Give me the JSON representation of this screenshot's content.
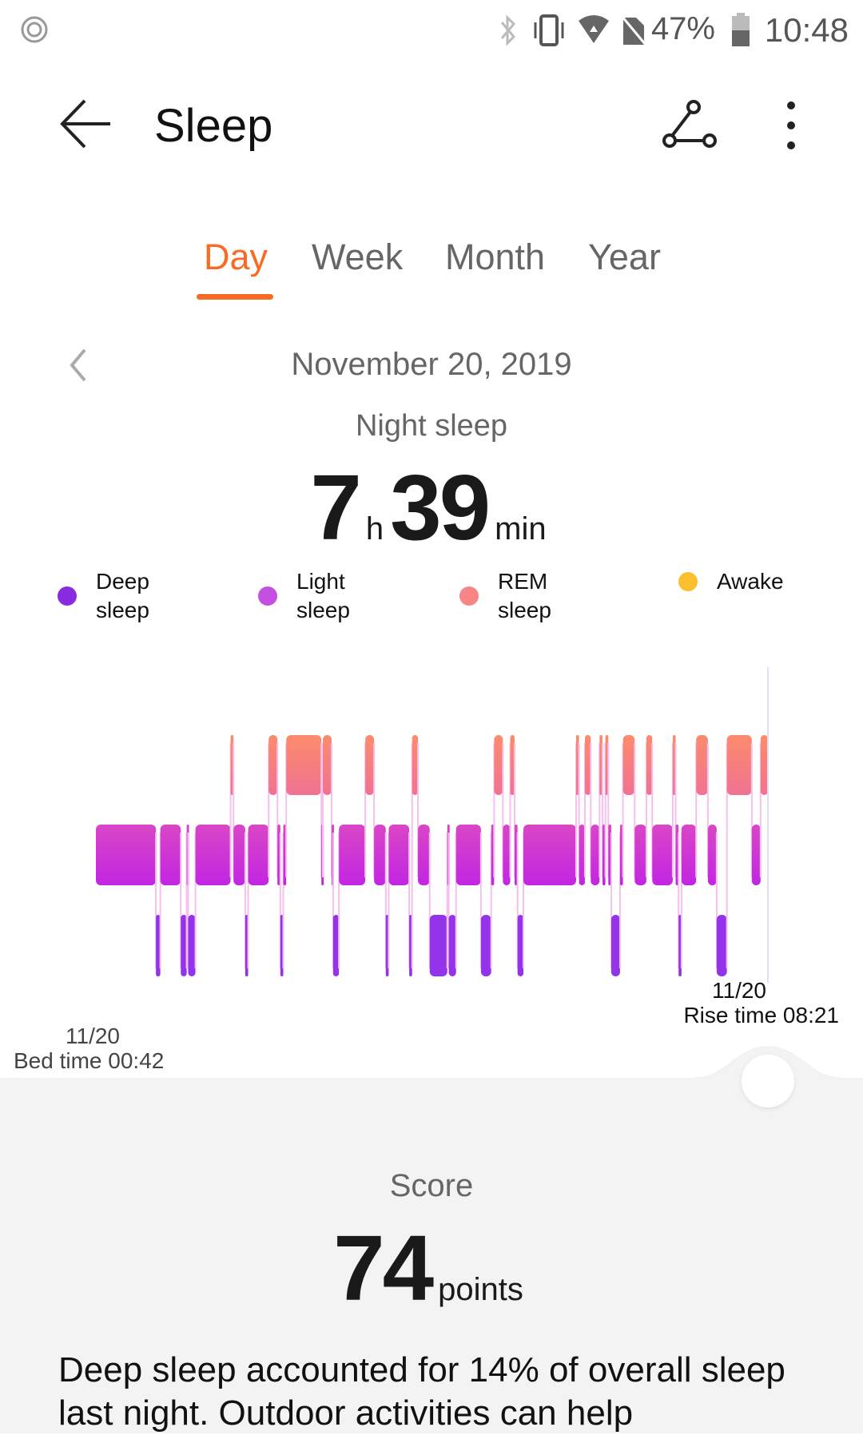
{
  "status_bar": {
    "battery": "47%",
    "time": "10:48",
    "icons": [
      "app-spiral-icon",
      "bluetooth-icon",
      "vibrate-icon",
      "wifi-icon",
      "no-sim-icon",
      "battery-icon"
    ]
  },
  "header": {
    "title": "Sleep",
    "back_icon": "arrow-left-icon",
    "share_icon": "share-icon",
    "more_icon": "more-vertical-icon"
  },
  "tabs": [
    {
      "label": "Day",
      "active": true
    },
    {
      "label": "Week"
    },
    {
      "label": "Month"
    },
    {
      "label": "Year"
    }
  ],
  "date": "November 20, 2019",
  "summary": {
    "label": "Night sleep",
    "hours": "7",
    "hours_unit": "h",
    "minutes": "39",
    "minutes_unit": "min"
  },
  "legend": [
    {
      "label": "Deep sleep",
      "color": "#8a2be2"
    },
    {
      "label": "Light sleep",
      "color": "#c44fe0"
    },
    {
      "label": "REM sleep",
      "color": "#f88585"
    },
    {
      "label": "Awake",
      "color": "#fbc02d"
    }
  ],
  "chart_data": {
    "type": "bar",
    "levels": [
      "Awake",
      "REM sleep",
      "Light sleep",
      "Deep sleep"
    ],
    "start": "00:42",
    "end": "08:21",
    "segments": [
      [
        "00:42",
        "light"
      ],
      [
        "01:23",
        "deep"
      ],
      [
        "01:26",
        "light"
      ],
      [
        "01:40",
        "deep"
      ],
      [
        "01:44",
        "light"
      ],
      [
        "01:45",
        "deep"
      ],
      [
        "01:50",
        "light"
      ],
      [
        "02:14",
        "rem"
      ],
      [
        "02:16",
        "light"
      ],
      [
        "02:24",
        "deep"
      ],
      [
        "02:26",
        "light"
      ],
      [
        "02:40",
        "rem"
      ],
      [
        "02:46",
        "light"
      ],
      [
        "02:48",
        "deep"
      ],
      [
        "02:50",
        "light"
      ],
      [
        "02:52",
        "rem"
      ],
      [
        "03:16",
        "light"
      ],
      [
        "03:17",
        "rem"
      ],
      [
        "03:23",
        "light"
      ],
      [
        "03:24",
        "deep"
      ],
      [
        "03:28",
        "light"
      ],
      [
        "03:46",
        "rem"
      ],
      [
        "03:52",
        "light"
      ],
      [
        "04:00",
        "deep"
      ],
      [
        "04:02",
        "light"
      ],
      [
        "04:16",
        "deep"
      ],
      [
        "04:18",
        "rem"
      ],
      [
        "04:22",
        "light"
      ],
      [
        "04:30",
        "deep"
      ],
      [
        "04:42",
        "light"
      ],
      [
        "04:43",
        "deep"
      ],
      [
        "04:48",
        "light"
      ],
      [
        "05:05",
        "deep"
      ],
      [
        "05:12",
        "light"
      ],
      [
        "05:14",
        "rem"
      ],
      [
        "05:20",
        "light"
      ],
      [
        "05:25",
        "rem"
      ],
      [
        "05:28",
        "light"
      ],
      [
        "05:30",
        "deep"
      ],
      [
        "05:34",
        "light"
      ],
      [
        "06:10",
        "rem"
      ],
      [
        "06:12",
        "light"
      ],
      [
        "06:16",
        "rem"
      ],
      [
        "06:20",
        "light"
      ],
      [
        "06:26",
        "rem"
      ],
      [
        "06:28",
        "light"
      ],
      [
        "06:30",
        "rem"
      ],
      [
        "06:32",
        "light"
      ],
      [
        "06:34",
        "deep"
      ],
      [
        "06:40",
        "light"
      ],
      [
        "06:42",
        "rem"
      ],
      [
        "06:50",
        "light"
      ],
      [
        "06:58",
        "rem"
      ],
      [
        "07:02",
        "light"
      ],
      [
        "07:16",
        "rem"
      ],
      [
        "07:18",
        "light"
      ],
      [
        "07:20",
        "deep"
      ],
      [
        "07:22",
        "light"
      ],
      [
        "07:32",
        "rem"
      ],
      [
        "07:40",
        "light"
      ],
      [
        "07:46",
        "deep"
      ],
      [
        "07:53",
        "rem"
      ],
      [
        "08:10",
        "light"
      ],
      [
        "08:16",
        "rem"
      ]
    ],
    "rise": {
      "date": "11/20",
      "label": "Rise time 08:21"
    },
    "bed": {
      "date": "11/20",
      "label": "Bed time 00:42"
    }
  },
  "score": {
    "label": "Score",
    "value": "74",
    "unit": "points"
  },
  "insight": "Deep sleep accounted for 14% of overall sleep last night. Outdoor activities can help"
}
